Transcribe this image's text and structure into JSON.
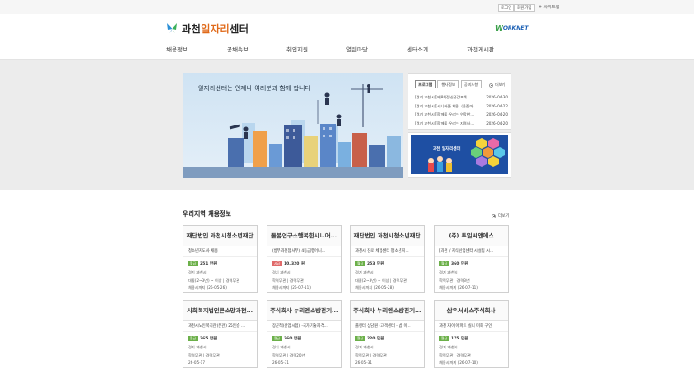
{
  "topbar": {
    "login": "로그인",
    "signup": "회원가입",
    "sitemap": "+ 사이트맵"
  },
  "header": {
    "logo": {
      "part1": "과천",
      "highlight": "일자리",
      "part2": "센터"
    },
    "partner": {
      "prefix": "W",
      "text": "ORKNET"
    }
  },
  "nav": [
    "채용정보",
    "공채속보",
    "취업지원",
    "열린마당",
    "센터소개",
    "과천게시판"
  ],
  "banner": {
    "caption": "일자리센터는 언제나 여러분과 함께 합니다"
  },
  "board": {
    "tabs": [
      "프로그램",
      "행사정보",
      "공지사항"
    ],
    "more": "더보기",
    "rows": [
      {
        "title": "[경기 과천시][제8회정신건강포렉...",
        "date": "2026-04-30"
      },
      {
        "title": "[경기 과천시][시니어존 채용..(올중마...",
        "date": "2026-04-22"
      },
      {
        "title": "[경기 과천시][함께풀 우리는 연합한...",
        "date": "2026-04-20"
      },
      {
        "title": "[경기 과천시][함께풀 우리는 지역사...",
        "date": "2026-04-20"
      }
    ]
  },
  "promo": {
    "title": "과천 일자리센터"
  },
  "jobs": {
    "title": "우리지역 채용정보",
    "more": "더보기",
    "cards": [
      {
        "company": "재단법인 과천시청소년재단",
        "subtitle": "청소년지도사 채용",
        "pay_type": "월급",
        "pay": "251 만원",
        "location": "경기 과천시",
        "requirement": "대졸(2~3년) ~ 이상 | 경력무관",
        "deadline": "채용시까지 (26-05-26)"
      },
      {
        "company": "돌봄연구소행복한시니어...",
        "subtitle": "(방부과천점사무) 4등급행어니...",
        "pay_type": "시급",
        "pay": "10,320 원",
        "location": "경기 과천시",
        "requirement": "학력무관 | 경력무관",
        "deadline": "채용시까지 (26-07-11)"
      },
      {
        "company": "재단법인 과천시청소년재단",
        "subtitle": "과천시 진로 체험센터 청소년지...",
        "pay_type": "월급",
        "pay": "253 만원",
        "location": "경기 과천시",
        "requirement": "대졸(2~3년) ~ 이상 | 경력무관",
        "deadline": "채용시까지 (26-05-28)"
      },
      {
        "company": "(주) 투일씨앤에스",
        "subtitle": "[과천 / 지식산업센터 시설팀 시...",
        "pay_type": "월급",
        "pay": "360 만원",
        "location": "경기 과천시",
        "requirement": "학력무관 | 경력3년",
        "deadline": "채용시까지 (26-07-11)"
      },
      {
        "company": "사회복지법인큰소망과천...",
        "subtitle": "과천시노인복지관(본관) 25인승 ...",
        "pay_type": "월급",
        "pay": "265 만원",
        "location": "경기 과천시",
        "requirement": "학력무관 | 경력무관",
        "deadline": "26-05-17"
      },
      {
        "company": "주식회사 누리엔소방전기...",
        "subtitle": "장군적(산업시험) -국가기술자격...",
        "pay_type": "월급",
        "pay": "260 만원",
        "location": "경기 과천시",
        "requirement": "학력무관 | 경력20년",
        "deadline": "26-05-31"
      },
      {
        "company": "주식회사 누리엔소방전기...",
        "subtitle": "플랜터 상담원 (고객센터 - 법 이...",
        "pay_type": "월급",
        "pay": "220 만원",
        "location": "경기 과천시",
        "requirement": "학력무관 | 경력무관",
        "deadline": "26-05-31"
      },
      {
        "company": "삼우서비스주식회사",
        "subtitle": "과천 자이 아파트 실내 미화 구인",
        "pay_type": "월급",
        "pay": "175 만원",
        "location": "경기 과천시",
        "requirement": "학력무관 | 경력무관",
        "deadline": "채용시까지 (26-07-10)"
      }
    ]
  },
  "colors": {
    "accent": "#e06a1a",
    "monthly_badge": "#6cb04a",
    "hourly_badge": "#e06a6a",
    "banner_sky": "#cfe3f3",
    "promo_bg": "#1e4fa3"
  }
}
